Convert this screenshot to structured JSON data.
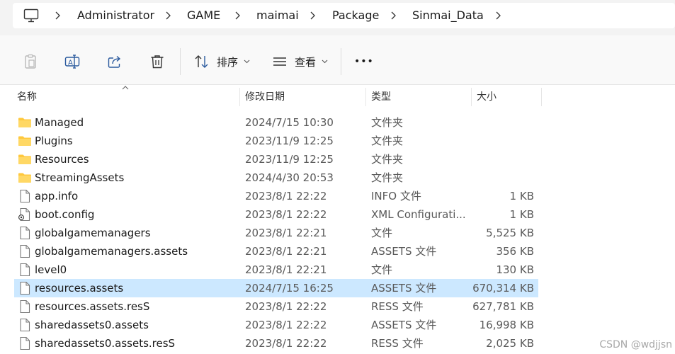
{
  "address_bar": {
    "icon": "this-pc-icon",
    "crumbs": [
      "Administrator",
      "GAME",
      "maimai",
      "Package",
      "Sinmai_Data"
    ]
  },
  "toolbar": {
    "icons": [
      "paste-icon",
      "rename-icon",
      "share-icon",
      "delete-icon"
    ],
    "sort_label": "排序",
    "view_label": "查看",
    "more_label": "•••"
  },
  "columns": {
    "name": "名称",
    "date": "修改日期",
    "type": "类型",
    "size": "大小"
  },
  "files": [
    {
      "name": "Managed",
      "date": "2024/7/15 10:30",
      "type": "文件夹",
      "size": "",
      "icon": "folder-icon",
      "selected": false
    },
    {
      "name": "Plugins",
      "date": "2023/11/9 12:25",
      "type": "文件夹",
      "size": "",
      "icon": "folder-icon",
      "selected": false
    },
    {
      "name": "Resources",
      "date": "2023/11/9 12:25",
      "type": "文件夹",
      "size": "",
      "icon": "folder-icon",
      "selected": false
    },
    {
      "name": "StreamingAssets",
      "date": "2024/4/30 20:53",
      "type": "文件夹",
      "size": "",
      "icon": "folder-icon",
      "selected": false
    },
    {
      "name": "app.info",
      "date": "2023/8/1 22:22",
      "type": "INFO 文件",
      "size": "1 KB",
      "icon": "file-icon",
      "selected": false
    },
    {
      "name": "boot.config",
      "date": "2023/8/1 22:22",
      "type": "XML Configurati...",
      "size": "1 KB",
      "icon": "config-file-icon",
      "selected": false
    },
    {
      "name": "globalgamemanagers",
      "date": "2023/8/1 22:21",
      "type": "文件",
      "size": "5,525 KB",
      "icon": "file-icon",
      "selected": false
    },
    {
      "name": "globalgamemanagers.assets",
      "date": "2023/8/1 22:21",
      "type": "ASSETS 文件",
      "size": "356 KB",
      "icon": "file-icon",
      "selected": false
    },
    {
      "name": "level0",
      "date": "2023/8/1 22:21",
      "type": "文件",
      "size": "130 KB",
      "icon": "file-icon",
      "selected": false
    },
    {
      "name": "resources.assets",
      "date": "2024/7/15 16:25",
      "type": "ASSETS 文件",
      "size": "670,314 KB",
      "icon": "file-icon",
      "selected": true
    },
    {
      "name": "resources.assets.resS",
      "date": "2023/8/1 22:22",
      "type": "RESS 文件",
      "size": "627,781 KB",
      "icon": "file-icon",
      "selected": false
    },
    {
      "name": "sharedassets0.assets",
      "date": "2023/8/1 22:22",
      "type": "ASSETS 文件",
      "size": "16,998 KB",
      "icon": "file-icon",
      "selected": false
    },
    {
      "name": "sharedassets0.assets.resS",
      "date": "2023/8/1 22:22",
      "type": "RESS 文件",
      "size": "2,025 KB",
      "icon": "file-icon",
      "selected": false
    }
  ],
  "colors": {
    "selection": "#cce8ff",
    "folder": "#ffc83d",
    "accent": "#0067c0"
  },
  "watermark": "CSDN @wdjjsn"
}
